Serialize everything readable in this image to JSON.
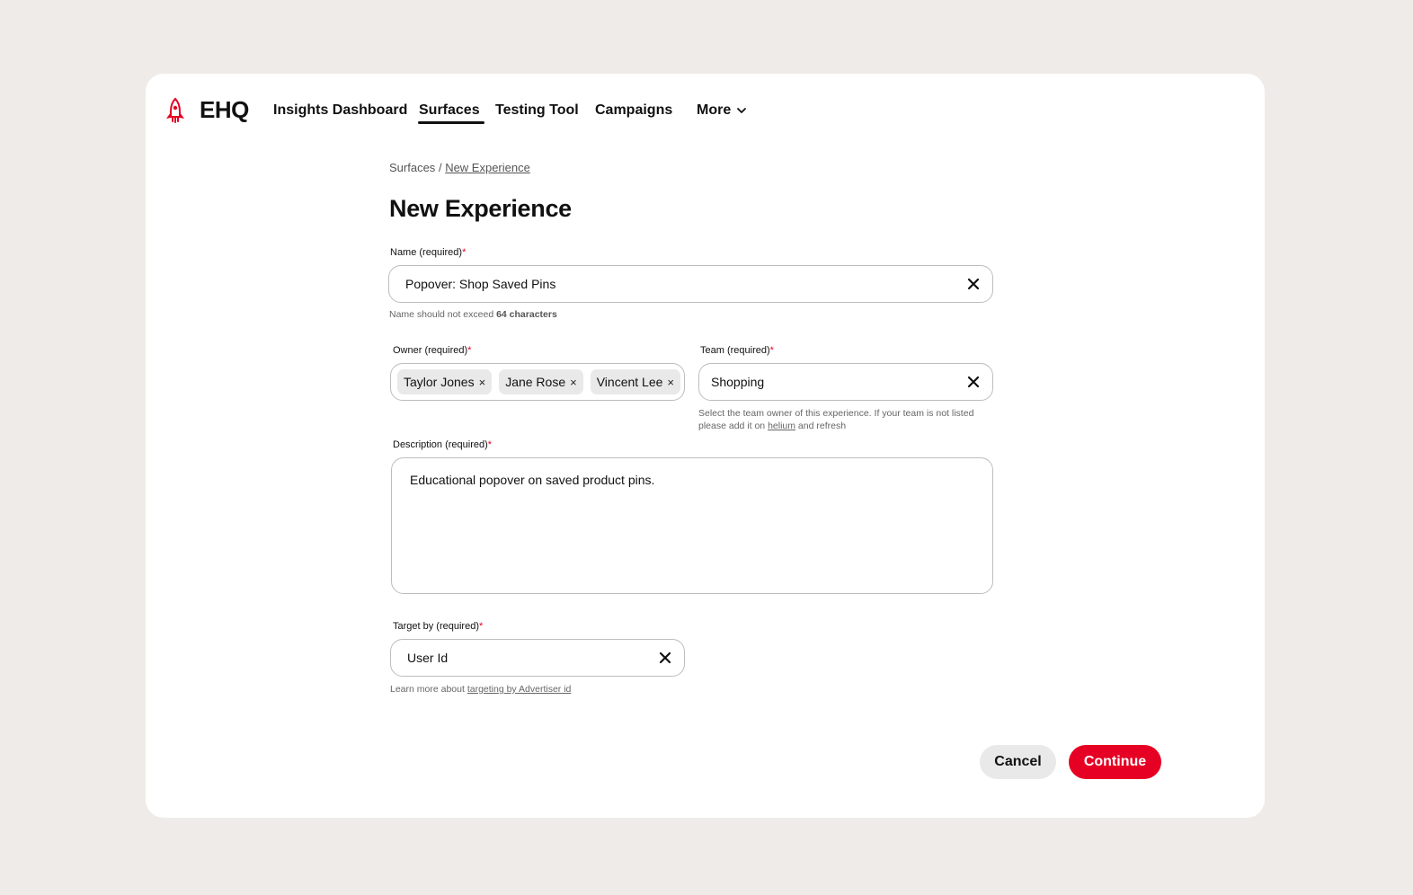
{
  "brand": {
    "name": "EHQ",
    "accent_color": "#e60023",
    "icon": "rocket-icon"
  },
  "nav": {
    "items": [
      {
        "label": "Insights Dashboard"
      },
      {
        "label": "Surfaces",
        "active": true
      },
      {
        "label": "Testing Tool"
      },
      {
        "label": "Campaigns"
      }
    ],
    "more_label": "More"
  },
  "breadcrumb": {
    "root": "Surfaces",
    "separator": "/",
    "current": "New Experience"
  },
  "page_title": "New Experience",
  "form": {
    "name": {
      "label": "Name (required)",
      "required_mark": "*",
      "value": "Popover: Shop Saved Pins",
      "helper_prefix": "Name should not exceed ",
      "helper_bold": "64 characters"
    },
    "owner": {
      "label": "Owner (required)",
      "required_mark": "*",
      "chips": [
        "Taylor Jones",
        "Jane Rose",
        "Vincent Lee"
      ],
      "chip_remove": "×"
    },
    "team": {
      "label": "Team (required)",
      "required_mark": "*",
      "value": "Shopping",
      "helper_line1": "Select the team owner of this experience. If your team is not listed",
      "helper_line2_prefix": "please add it on ",
      "helper_link": "helium",
      "helper_line2_suffix": " and refresh"
    },
    "description": {
      "label": "Description (required)",
      "required_mark": "*",
      "value": "Educational popover on saved product pins."
    },
    "target": {
      "label": "Target by (required)",
      "required_mark": "*",
      "value": "User Id",
      "helper_prefix": "Learn more about ",
      "helper_link": "targeting by Advertiser id"
    }
  },
  "actions": {
    "cancel_label": "Cancel",
    "continue_label": "Continue"
  }
}
